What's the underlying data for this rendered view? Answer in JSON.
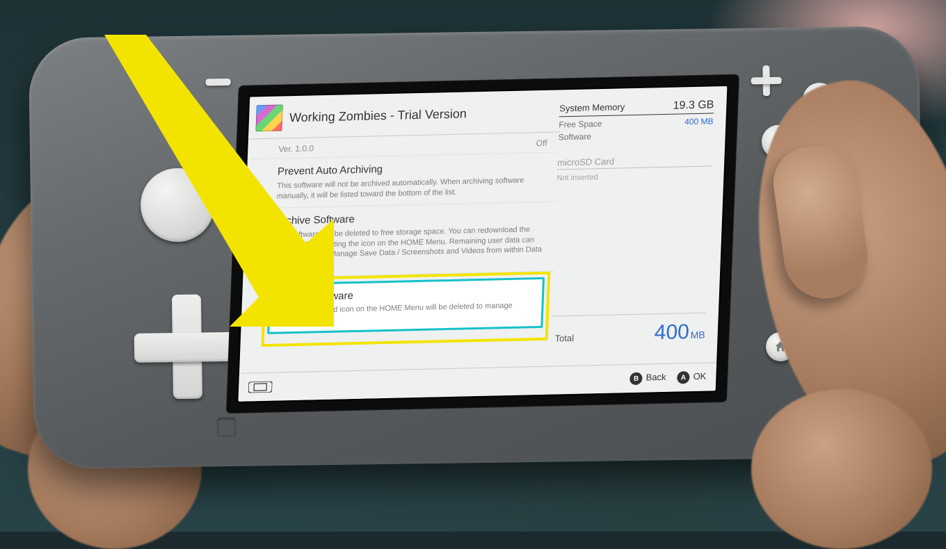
{
  "header": {
    "title": "Working Zombies - Trial Version",
    "version_label": "Ver. 1.0.0",
    "play_status": "Off"
  },
  "sections": {
    "prevent": {
      "title": "Prevent Auto Archiving",
      "desc": "This software will not be archived automatically. When archiving software manually, it will be listed toward the bottom of the list."
    },
    "archive": {
      "title": "Archive Software",
      "desc": "The software will be deleted to free storage space. You can redownload the software by selecting the icon on the HOME Menu. Remaining user data can be deleted from Manage Save Data / Screenshots and Videos from within Data Management."
    },
    "delete": {
      "title": "Delete Software",
      "desc": "The software and icon on the HOME Menu will be deleted to manage storage"
    }
  },
  "memory": {
    "system_label": "System Memory",
    "system_total": "19.3 GB",
    "free_label": "Free Space",
    "free_value": "400 MB",
    "software_label": "Software",
    "sd_label": "microSD Card",
    "sd_note": "Not inserted",
    "total_label": "Total",
    "total_value": "400",
    "total_unit": "MB"
  },
  "footer": {
    "back_label": "Back",
    "ok_label": "OK"
  }
}
